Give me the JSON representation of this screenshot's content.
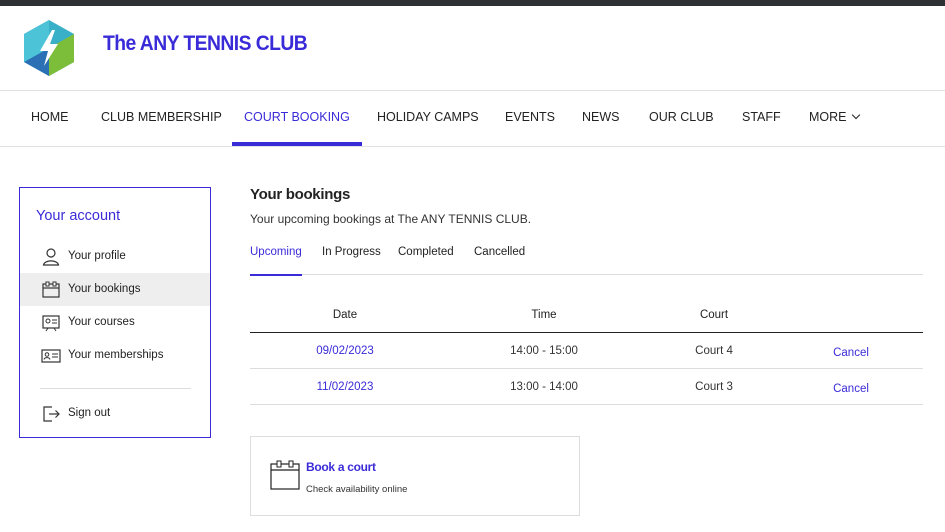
{
  "brand": {
    "name": "The ANY TENNIS CLUB",
    "colors": {
      "accent": "#3a2bd8",
      "logo_light": "#3ab0c8",
      "logo_blue": "#2b6fb5",
      "logo_green": "#7cbd3a"
    }
  },
  "nav": {
    "items": [
      {
        "label": "HOME"
      },
      {
        "label": "CLUB MEMBERSHIP"
      },
      {
        "label": "COURT BOOKING",
        "active": true
      },
      {
        "label": "HOLIDAY CAMPS"
      },
      {
        "label": "EVENTS"
      },
      {
        "label": "NEWS"
      },
      {
        "label": "OUR CLUB"
      },
      {
        "label": "STAFF"
      },
      {
        "label": "MORE",
        "icon": "chevron-down-icon"
      }
    ]
  },
  "account": {
    "title": "Your account",
    "items": [
      {
        "label": "Your profile",
        "icon": "person-icon"
      },
      {
        "label": "Your bookings",
        "icon": "calendar-icon",
        "active": true
      },
      {
        "label": "Your courses",
        "icon": "courses-icon"
      },
      {
        "label": "Your memberships",
        "icon": "id-card-icon"
      }
    ],
    "sign_out": {
      "label": "Sign out",
      "icon": "sign-out-icon"
    }
  },
  "bookings": {
    "title": "Your bookings",
    "subtitle": "Your upcoming bookings at The ANY TENNIS CLUB.",
    "tabs": [
      {
        "label": "Upcoming",
        "active": true
      },
      {
        "label": "In Progress"
      },
      {
        "label": "Completed"
      },
      {
        "label": "Cancelled"
      }
    ],
    "columns": {
      "date": "Date",
      "time": "Time",
      "court": "Court"
    },
    "rows": [
      {
        "date": "09/02/2023",
        "time": "14:00 - 15:00",
        "court": "Court 4",
        "action": "Cancel"
      },
      {
        "date": "11/02/2023",
        "time": "13:00 - 14:00",
        "court": "Court 3",
        "action": "Cancel"
      }
    ]
  },
  "book_court": {
    "title": "Book a court",
    "subtitle": "Check availability online",
    "icon": "calendar-icon"
  }
}
